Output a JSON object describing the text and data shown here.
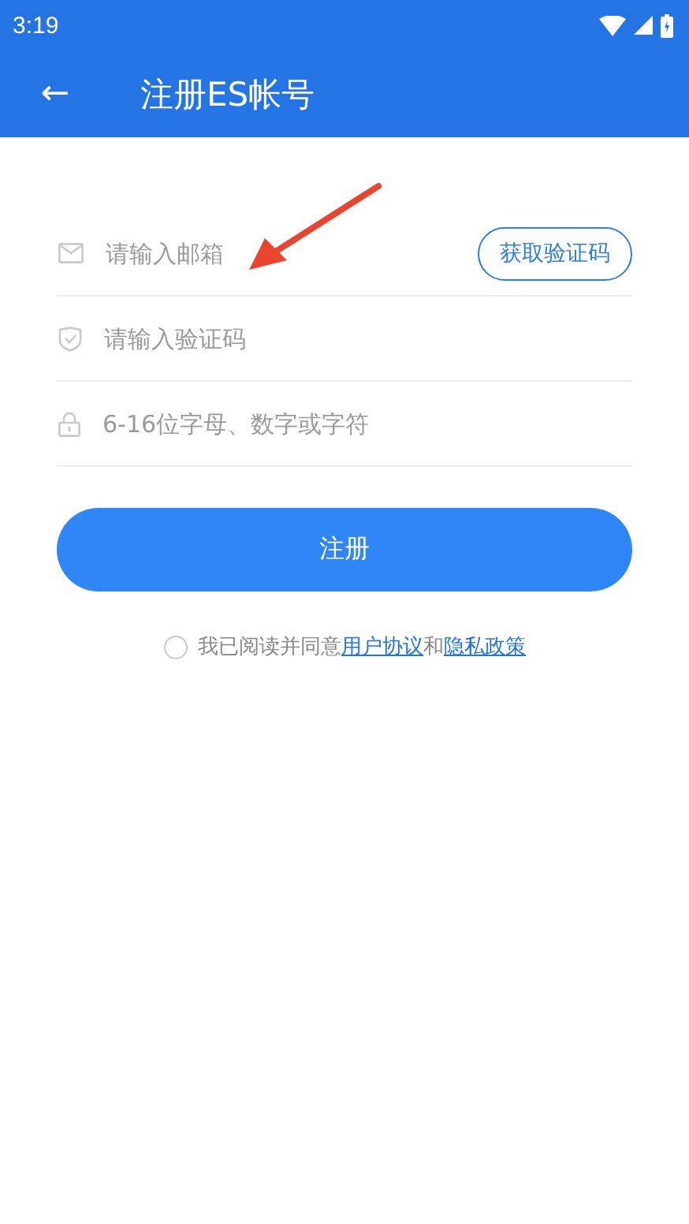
{
  "status_bar": {
    "time": "3:19"
  },
  "app_bar": {
    "back": "←",
    "title": "注册ES帐号"
  },
  "fields": [
    {
      "kind": "email",
      "placeholder": "请输入邮箱",
      "action": "获取验证码"
    },
    {
      "kind": "code",
      "placeholder": "请输入验证码"
    },
    {
      "kind": "password",
      "placeholder": "6-16位字母、数字或字符"
    }
  ],
  "submit": "注册",
  "agreement": {
    "checked": false,
    "prefix": "我已阅读并同意",
    "link_1": "用户协议",
    "joiner": "和",
    "link_2": "隐私政策"
  },
  "annotation": {
    "kind": "arrow"
  }
}
